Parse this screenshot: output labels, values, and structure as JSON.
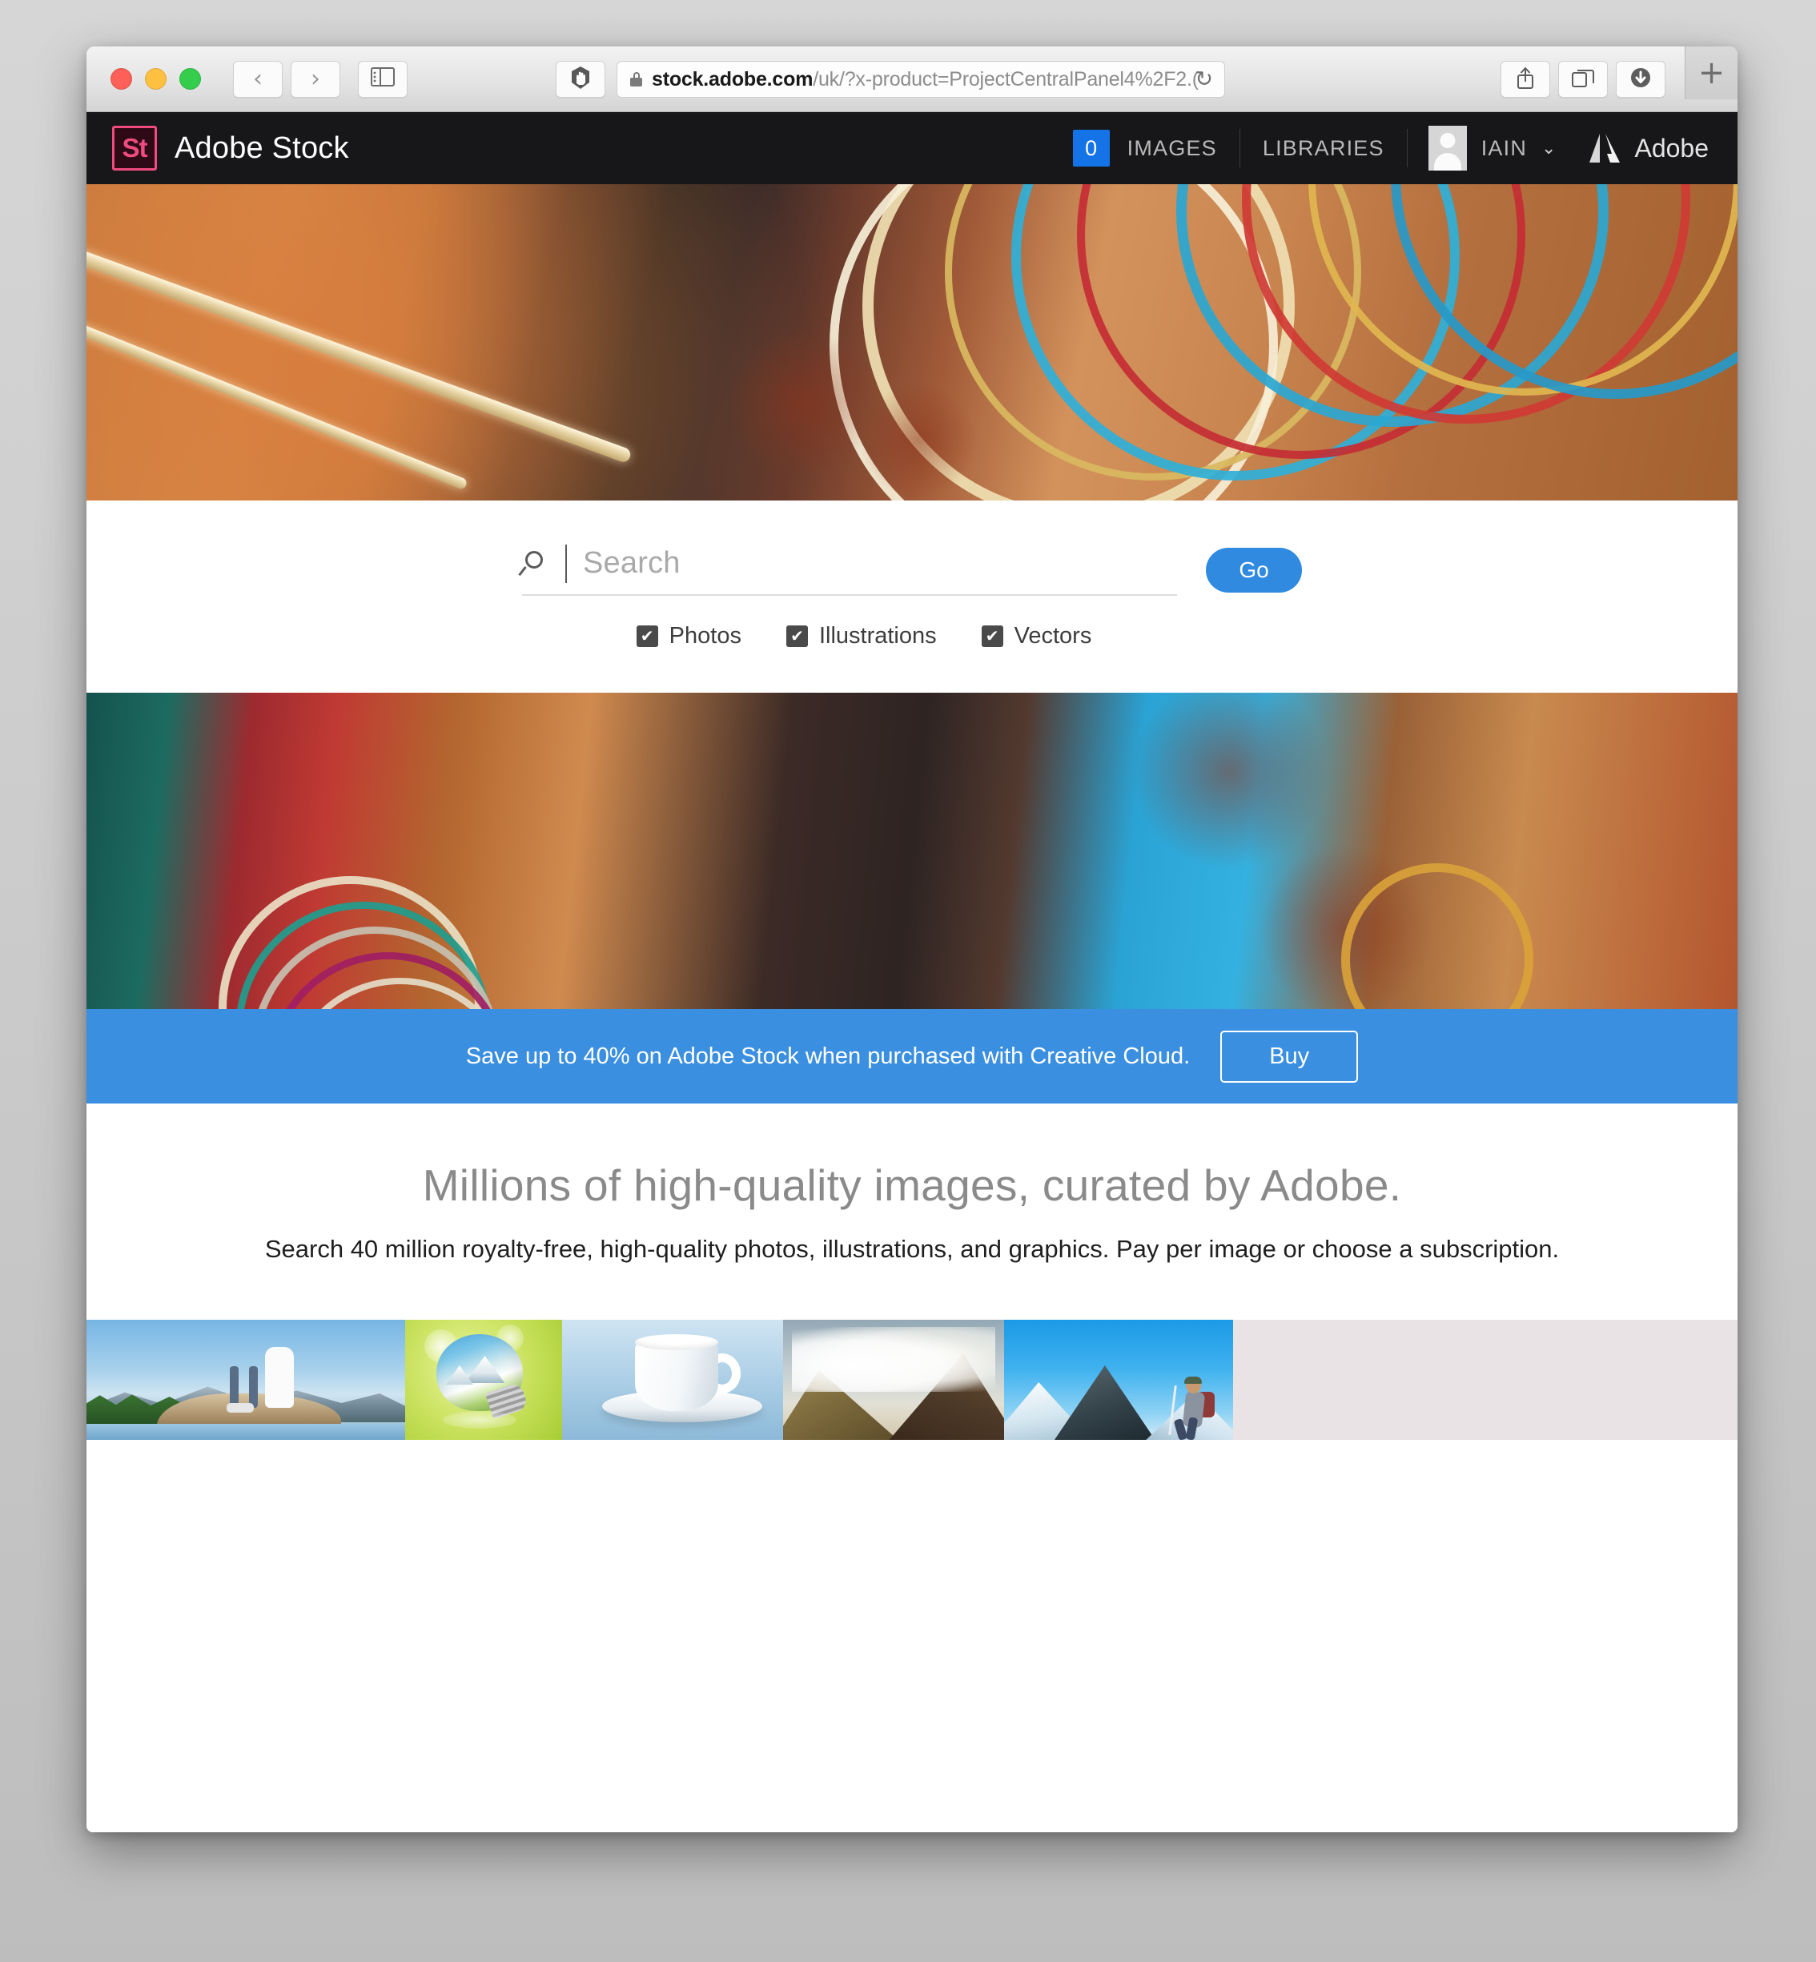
{
  "browser": {
    "traffic_lights": [
      "close",
      "minimize",
      "zoom"
    ],
    "back_label": "‹",
    "forward_label": "›",
    "url_host": "stock.adobe.com",
    "url_path": "/uk/?x-product=ProjectCentralPanel4%2F2.(",
    "reload_label": "↻",
    "new_tab_label": "+"
  },
  "site_nav": {
    "logo_text": "St",
    "brand_title": "Adobe Stock",
    "count_badge": "0",
    "images_label": "IMAGES",
    "libraries_label": "LIBRARIES",
    "user_name": "IAIN",
    "user_chevron": "⌄",
    "adobe_word": "Adobe"
  },
  "search": {
    "placeholder": "Search",
    "value": "",
    "go_label": "Go",
    "filters": [
      {
        "label": "Photos",
        "checked": true,
        "mark": "✔"
      },
      {
        "label": "Illustrations",
        "checked": true,
        "mark": "✔"
      },
      {
        "label": "Vectors",
        "checked": true,
        "mark": "✔"
      }
    ]
  },
  "promo": {
    "text": "Save up to 40% on Adobe Stock when purchased with Creative Cloud.",
    "buy_label": "Buy",
    "background_color": "#3b8fe0"
  },
  "marketing": {
    "headline": "Millions of high-quality images, curated by Adobe.",
    "subhead": "Search 40 million royalty-free, high-quality photos, illustrations, and graphics. Pay per image or choose a subscription."
  },
  "hero": {
    "top_alt": "Close-up of bride's arms with gold and pearl bangles and henna",
    "bottom_alt": "Bride's hennaed hands with teal and pink bangles and jewelled ring"
  },
  "thumbnails": [
    {
      "alt": "Hikers standing on rocky outcrop above mountain lake"
    },
    {
      "alt": "Light bulb containing green landscape with snowy peaks"
    },
    {
      "alt": "White coffee cup on saucer against blue background"
    },
    {
      "alt": "Clouds rolling over brown mountain ridges"
    },
    {
      "alt": "Mountain climber with backpack on snowy summit"
    }
  ],
  "colors": {
    "accent_blue": "#1473e6",
    "promo_blue": "#3b8fe0",
    "go_blue": "#2f8ae0",
    "nav_dark": "#17171a",
    "stock_pink": "#ef4b7f"
  }
}
